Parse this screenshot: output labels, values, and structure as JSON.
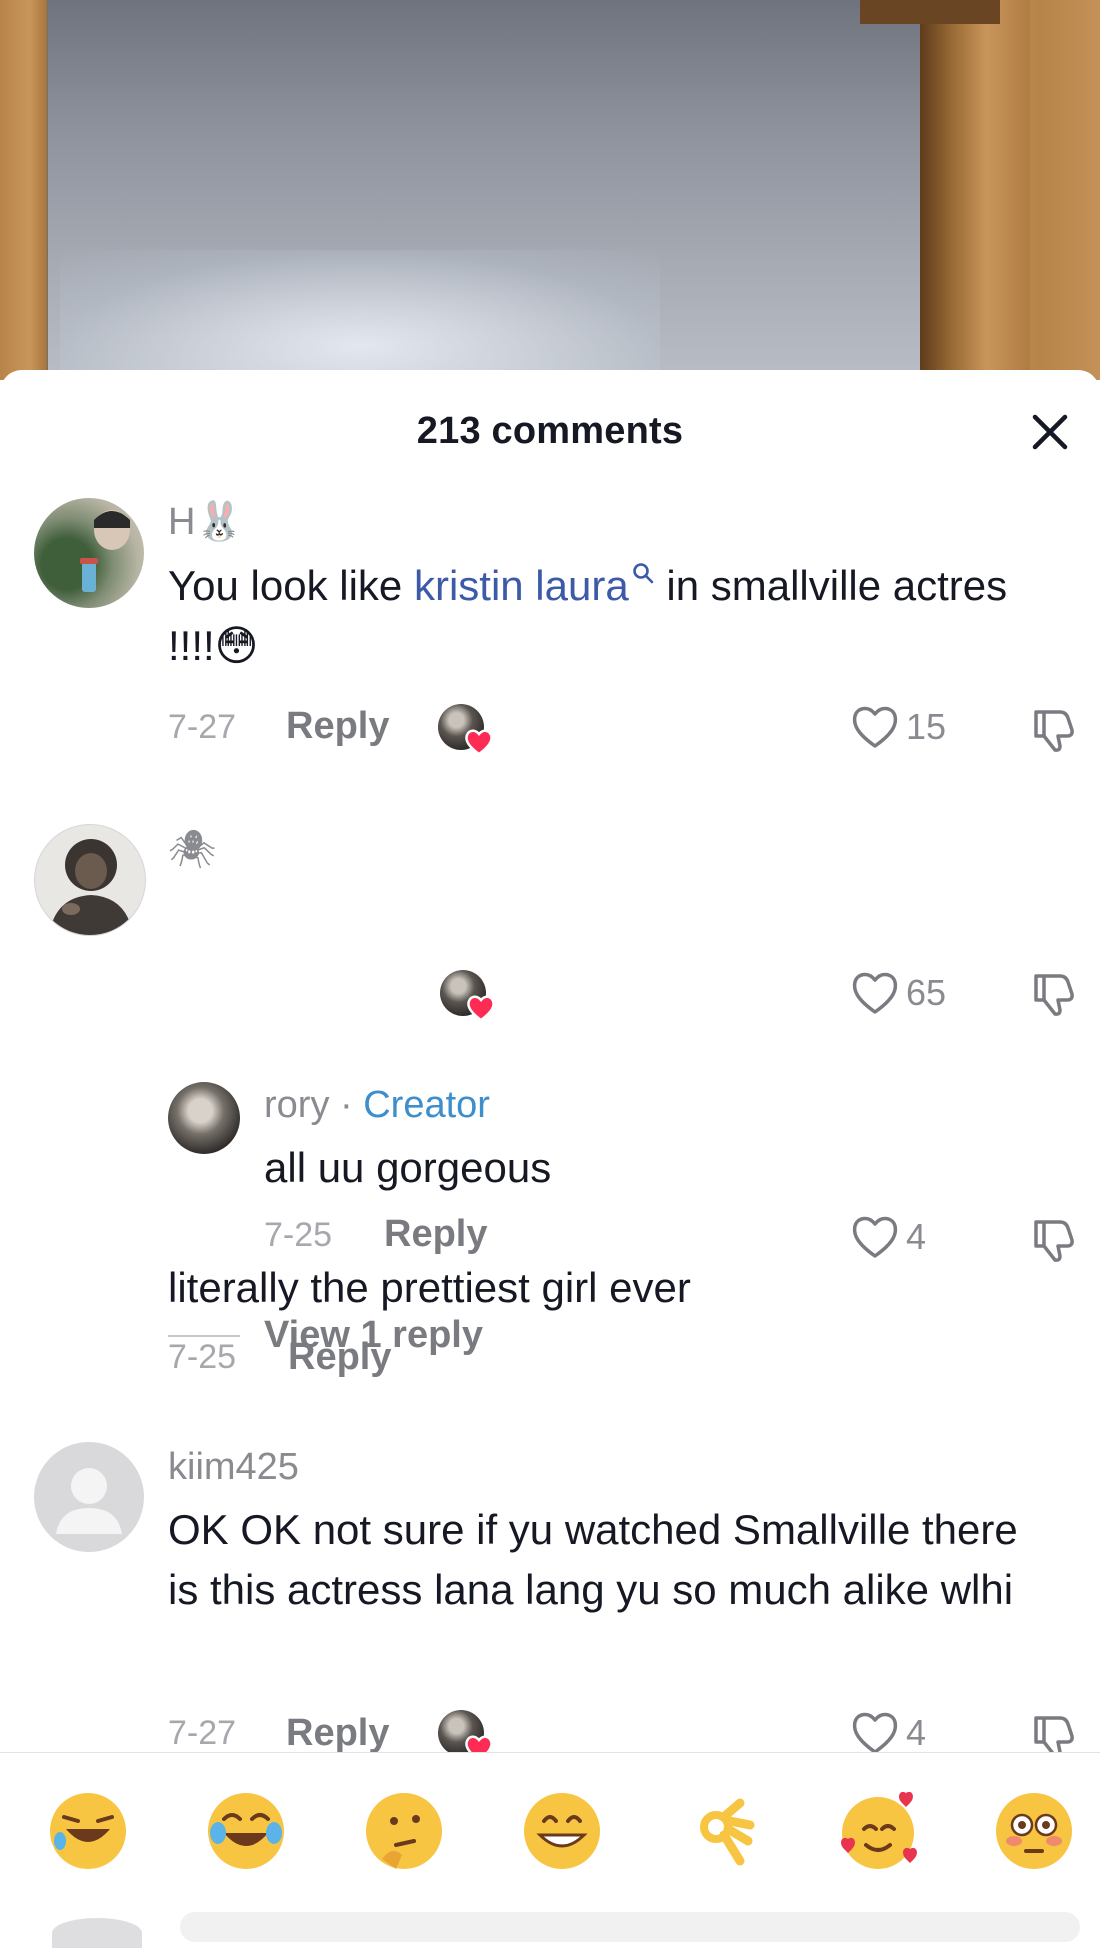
{
  "header": {
    "title": "213 comments"
  },
  "comments": [
    {
      "username": "H🐰",
      "text_before": "You look like ",
      "mention": "kristin laura",
      "text_after": " in smallville actres !!!!😳",
      "date": "7-27",
      "reply_label": "Reply",
      "likes": "15",
      "liked_by_creator": true
    },
    {
      "username": "🕷",
      "text": "literally the prettiest girl ever",
      "date": "7-25",
      "reply_label": "Reply",
      "likes": "65",
      "liked_by_creator": true
    },
    {
      "username": "kiim425",
      "text": "OK OK not sure if yu watched Smallville there is this actress lana lang yu so much alike wlhi",
      "date": "7-27",
      "reply_label": "Reply",
      "likes": "4",
      "liked_by_creator": true
    }
  ],
  "reply": {
    "username": "rory",
    "separator": "·",
    "badge": "Creator",
    "text": "all uu gorgeous",
    "date": "7-25",
    "reply_label": "Reply",
    "likes": "4"
  },
  "view_replies": "View 1 reply",
  "emoji_bar": [
    "🤣",
    "😂",
    "🤔",
    "😁",
    "👌",
    "🥰",
    "😳"
  ],
  "colors": {
    "mention": "#3d5aa8",
    "creator_badge": "#3c8fcc",
    "heart_badge": "#fe2c55",
    "text": "#161823",
    "secondary": "#8a8b91"
  },
  "icons": {
    "close": "close-icon",
    "like": "heart-outline-icon",
    "dislike": "thumbs-down-icon",
    "mention_search": "search-icon",
    "creator_liked": "heart-badge-icon"
  }
}
